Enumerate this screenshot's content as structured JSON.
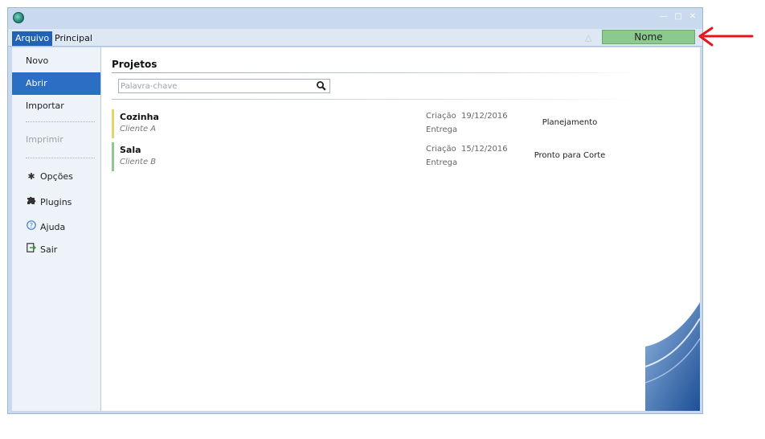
{
  "ribbon": {
    "tab_file": "Arquivo",
    "tab_main": "Principal",
    "user_button": "Nome"
  },
  "sidebar": {
    "items": [
      {
        "label": "Novo"
      },
      {
        "label": "Abrir"
      },
      {
        "label": "Importar"
      },
      {
        "label": "Imprimir"
      },
      {
        "label": "Opções"
      },
      {
        "label": "Plugins"
      },
      {
        "label": "Ajuda"
      },
      {
        "label": "Sair"
      }
    ]
  },
  "main": {
    "title": "Projetos",
    "search_placeholder": "Palavra-chave",
    "projects": [
      {
        "name": "Cozinha",
        "client": "Cliente A",
        "created_label": "Criação",
        "created_date": "19/12/2016",
        "delivery_label": "Entrega",
        "status": "Planejamento",
        "color": "#e6d46a"
      },
      {
        "name": "Sala",
        "client": "Cliente B",
        "created_label": "Criação",
        "created_date": "15/12/2016",
        "delivery_label": "Entrega",
        "status": "Pronto para Corte",
        "color": "#8cc98f"
      }
    ]
  },
  "colors": {
    "accent": "#2a6fc4",
    "user_button": "#8cc98f",
    "annotation_arrow": "#e8141c"
  },
  "icons": {
    "app": "app-logo-icon",
    "options": "gear-icon",
    "plugins": "puzzle-icon",
    "help": "question-circle-icon",
    "exit": "exit-door-icon",
    "search": "search-icon"
  }
}
